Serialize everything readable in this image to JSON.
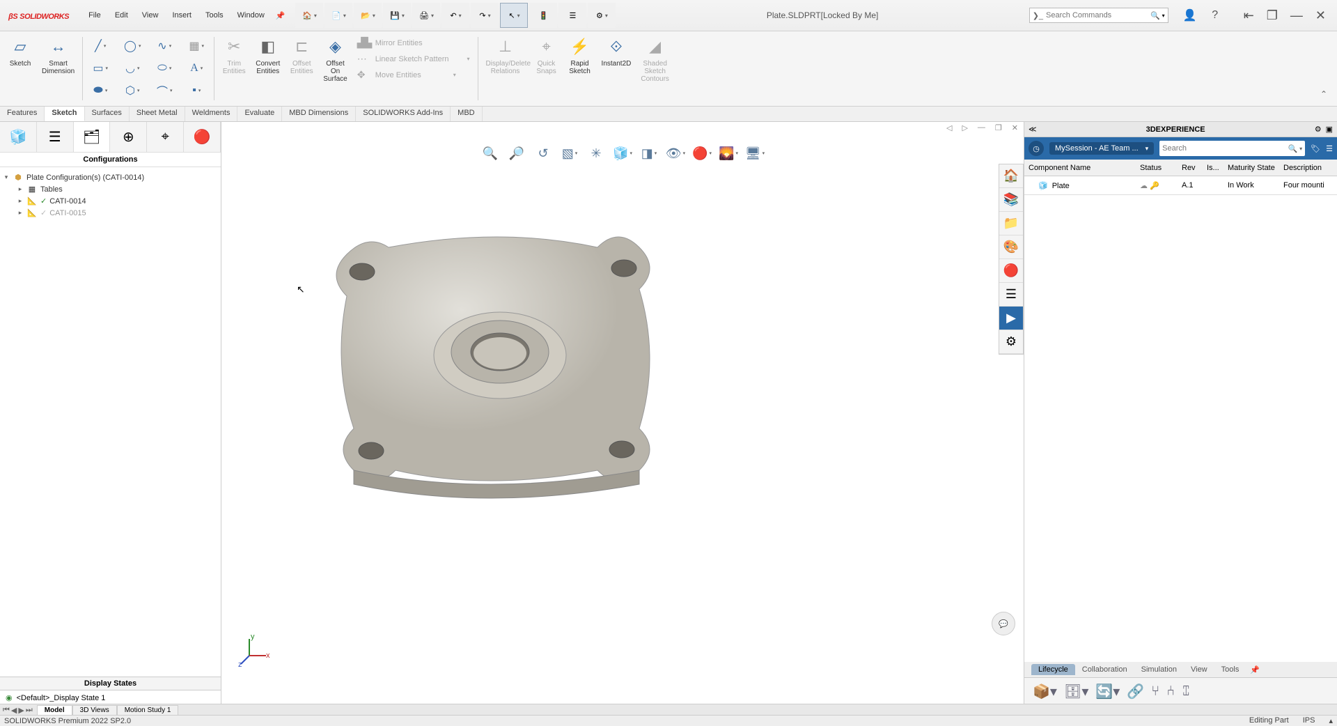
{
  "app": {
    "brand": "SOLIDWORKS",
    "doc_title": "Plate.SLDPRT[Locked By Me]"
  },
  "menubar": [
    "File",
    "Edit",
    "View",
    "Insert",
    "Tools",
    "Window"
  ],
  "search_commands_placeholder": "Search Commands",
  "ribbon": {
    "sketch_btn": "Sketch",
    "smart_dim": "Smart\nDimension",
    "trim": "Trim\nEntities",
    "convert": "Convert\nEntities",
    "offset": "Offset\nEntities",
    "offset_surface": "Offset\nOn\nSurface",
    "mirror": "Mirror Entities",
    "linear_pattern": "Linear Sketch Pattern",
    "move_entities": "Move Entities",
    "display_relations": "Display/Delete\nRelations",
    "quick_snaps": "Quick\nSnaps",
    "rapid_sketch": "Rapid\nSketch",
    "instant2d": "Instant2D",
    "shaded_contours": "Shaded\nSketch\nContours"
  },
  "ribbon_tabs": [
    "Features",
    "Sketch",
    "Surfaces",
    "Sheet Metal",
    "Weldments",
    "Evaluate",
    "MBD Dimensions",
    "SOLIDWORKS Add-Ins",
    "MBD"
  ],
  "active_ribbon_tab": "Sketch",
  "config_panel": {
    "header": "Configurations",
    "root": "Plate Configuration(s)  (CATI-0014)",
    "tables": "Tables",
    "cfg1": "CATI-0014",
    "cfg2": "CATI-0015",
    "display_states_header": "Display States",
    "display_state": "<Default>_Display State 1"
  },
  "doc_tabs": [
    "Model",
    "3D Views",
    "Motion Study 1"
  ],
  "active_doc_tab": "Model",
  "statusbar": {
    "left": "SOLIDWORKS Premium 2022 SP2.0",
    "mode": "Editing Part",
    "units": "IPS"
  },
  "panel3dx": {
    "title": "3DEXPERIENCE",
    "session": "MySession - AE Team ...",
    "search_placeholder": "Search",
    "cols": {
      "name": "Component Name",
      "status": "Status",
      "rev": "Rev",
      "is": "Is...",
      "maturity": "Maturity State",
      "desc": "Description"
    },
    "row": {
      "name": "Plate",
      "rev": "A.1",
      "maturity": "In Work",
      "desc": "Four mounti"
    },
    "tabs": [
      "Lifecycle",
      "Collaboration",
      "Simulation",
      "View",
      "Tools"
    ],
    "active_tab": "Lifecycle"
  },
  "triad": {
    "x": "x",
    "y": "y",
    "z": "z"
  }
}
